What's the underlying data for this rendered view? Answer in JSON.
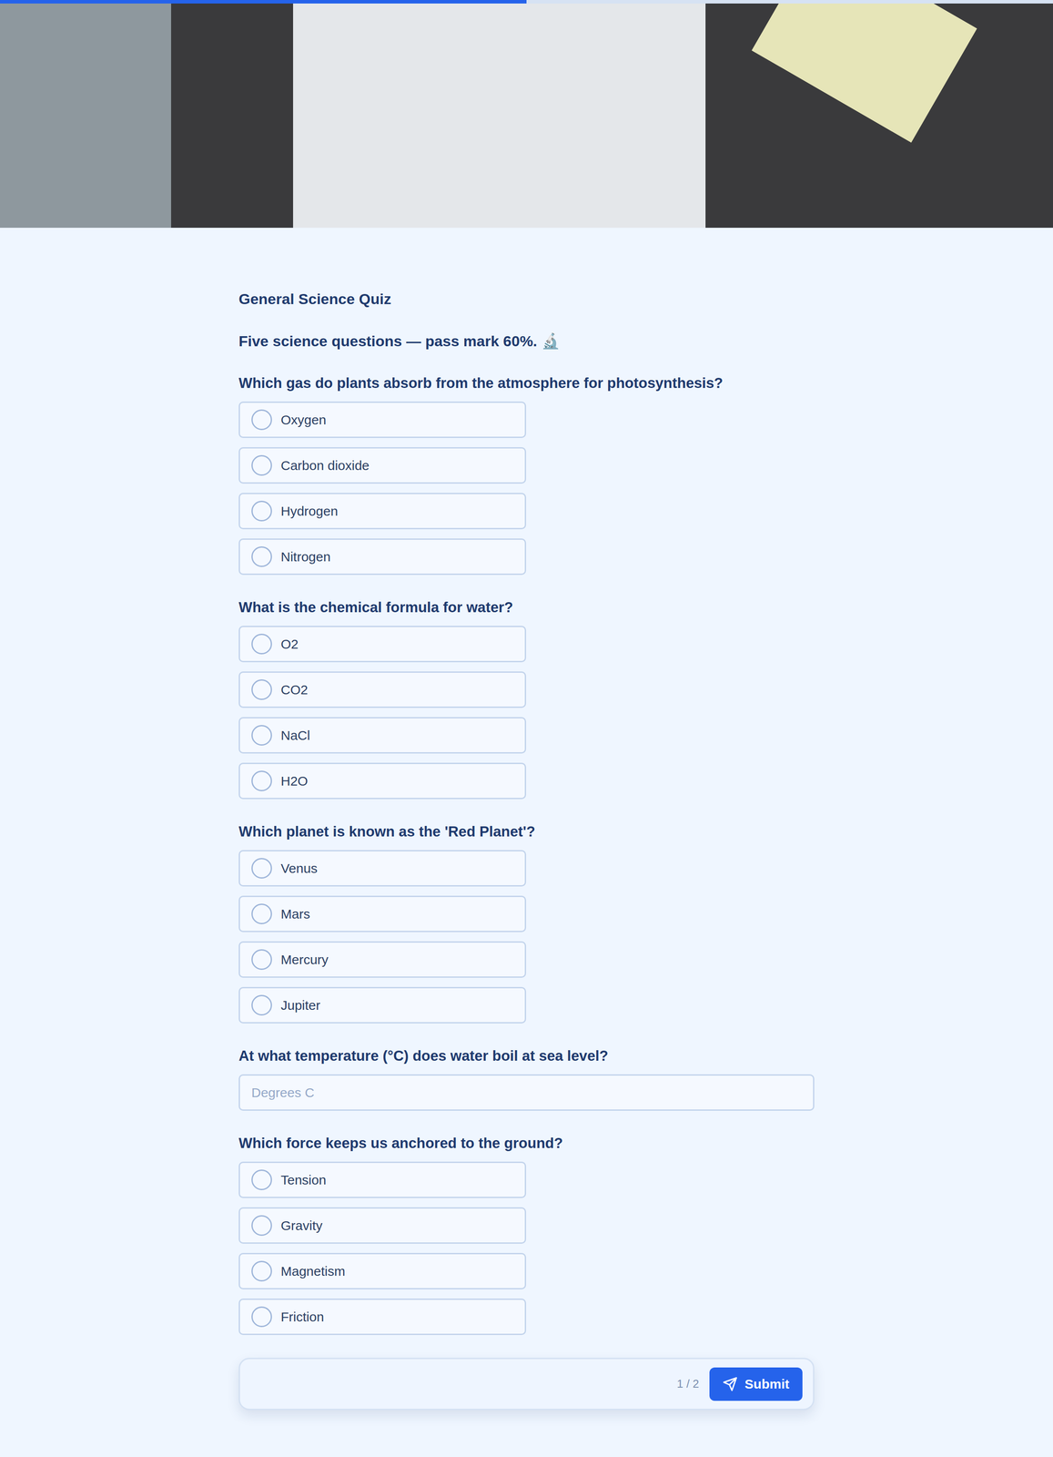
{
  "progress": {
    "level": 0.5
  },
  "quiz": {
    "title": "General Science Quiz",
    "description": "Five science questions — pass mark 60%. 🔬"
  },
  "questions": [
    {
      "kind": "choice",
      "text": "Which gas do plants absorb from the atmosphere for photosynthesis?",
      "options": [
        {
          "label": "Oxygen",
          "selected": false
        },
        {
          "label": "Carbon dioxide",
          "selected": false
        },
        {
          "label": "Hydrogen",
          "selected": false
        },
        {
          "label": "Nitrogen",
          "selected": false
        }
      ]
    },
    {
      "kind": "choice",
      "text": "What is the chemical formula for water?",
      "options": [
        {
          "label": "O2",
          "selected": false
        },
        {
          "label": "CO2",
          "selected": false
        },
        {
          "label": "NaCl",
          "selected": false
        },
        {
          "label": "H2O",
          "selected": false
        }
      ]
    },
    {
      "kind": "choice",
      "text": "Which planet is known as the 'Red Planet'?",
      "options": [
        {
          "label": "Venus",
          "selected": false
        },
        {
          "label": "Mars",
          "selected": false
        },
        {
          "label": "Mercury",
          "selected": false
        },
        {
          "label": "Jupiter",
          "selected": false
        }
      ]
    },
    {
      "kind": "number",
      "text": "At what temperature (°C) does water boil at sea level?",
      "placeholder": "Degrees C"
    },
    {
      "kind": "choice",
      "text": "Which force keeps us anchored to the ground?",
      "options": [
        {
          "label": "Tension",
          "selected": false
        },
        {
          "label": "Gravity",
          "selected": false
        },
        {
          "label": "Magnetism",
          "selected": false
        },
        {
          "label": "Friction",
          "selected": false
        }
      ]
    }
  ],
  "footer": {
    "page": "1 / 2",
    "submit": "Submit"
  }
}
